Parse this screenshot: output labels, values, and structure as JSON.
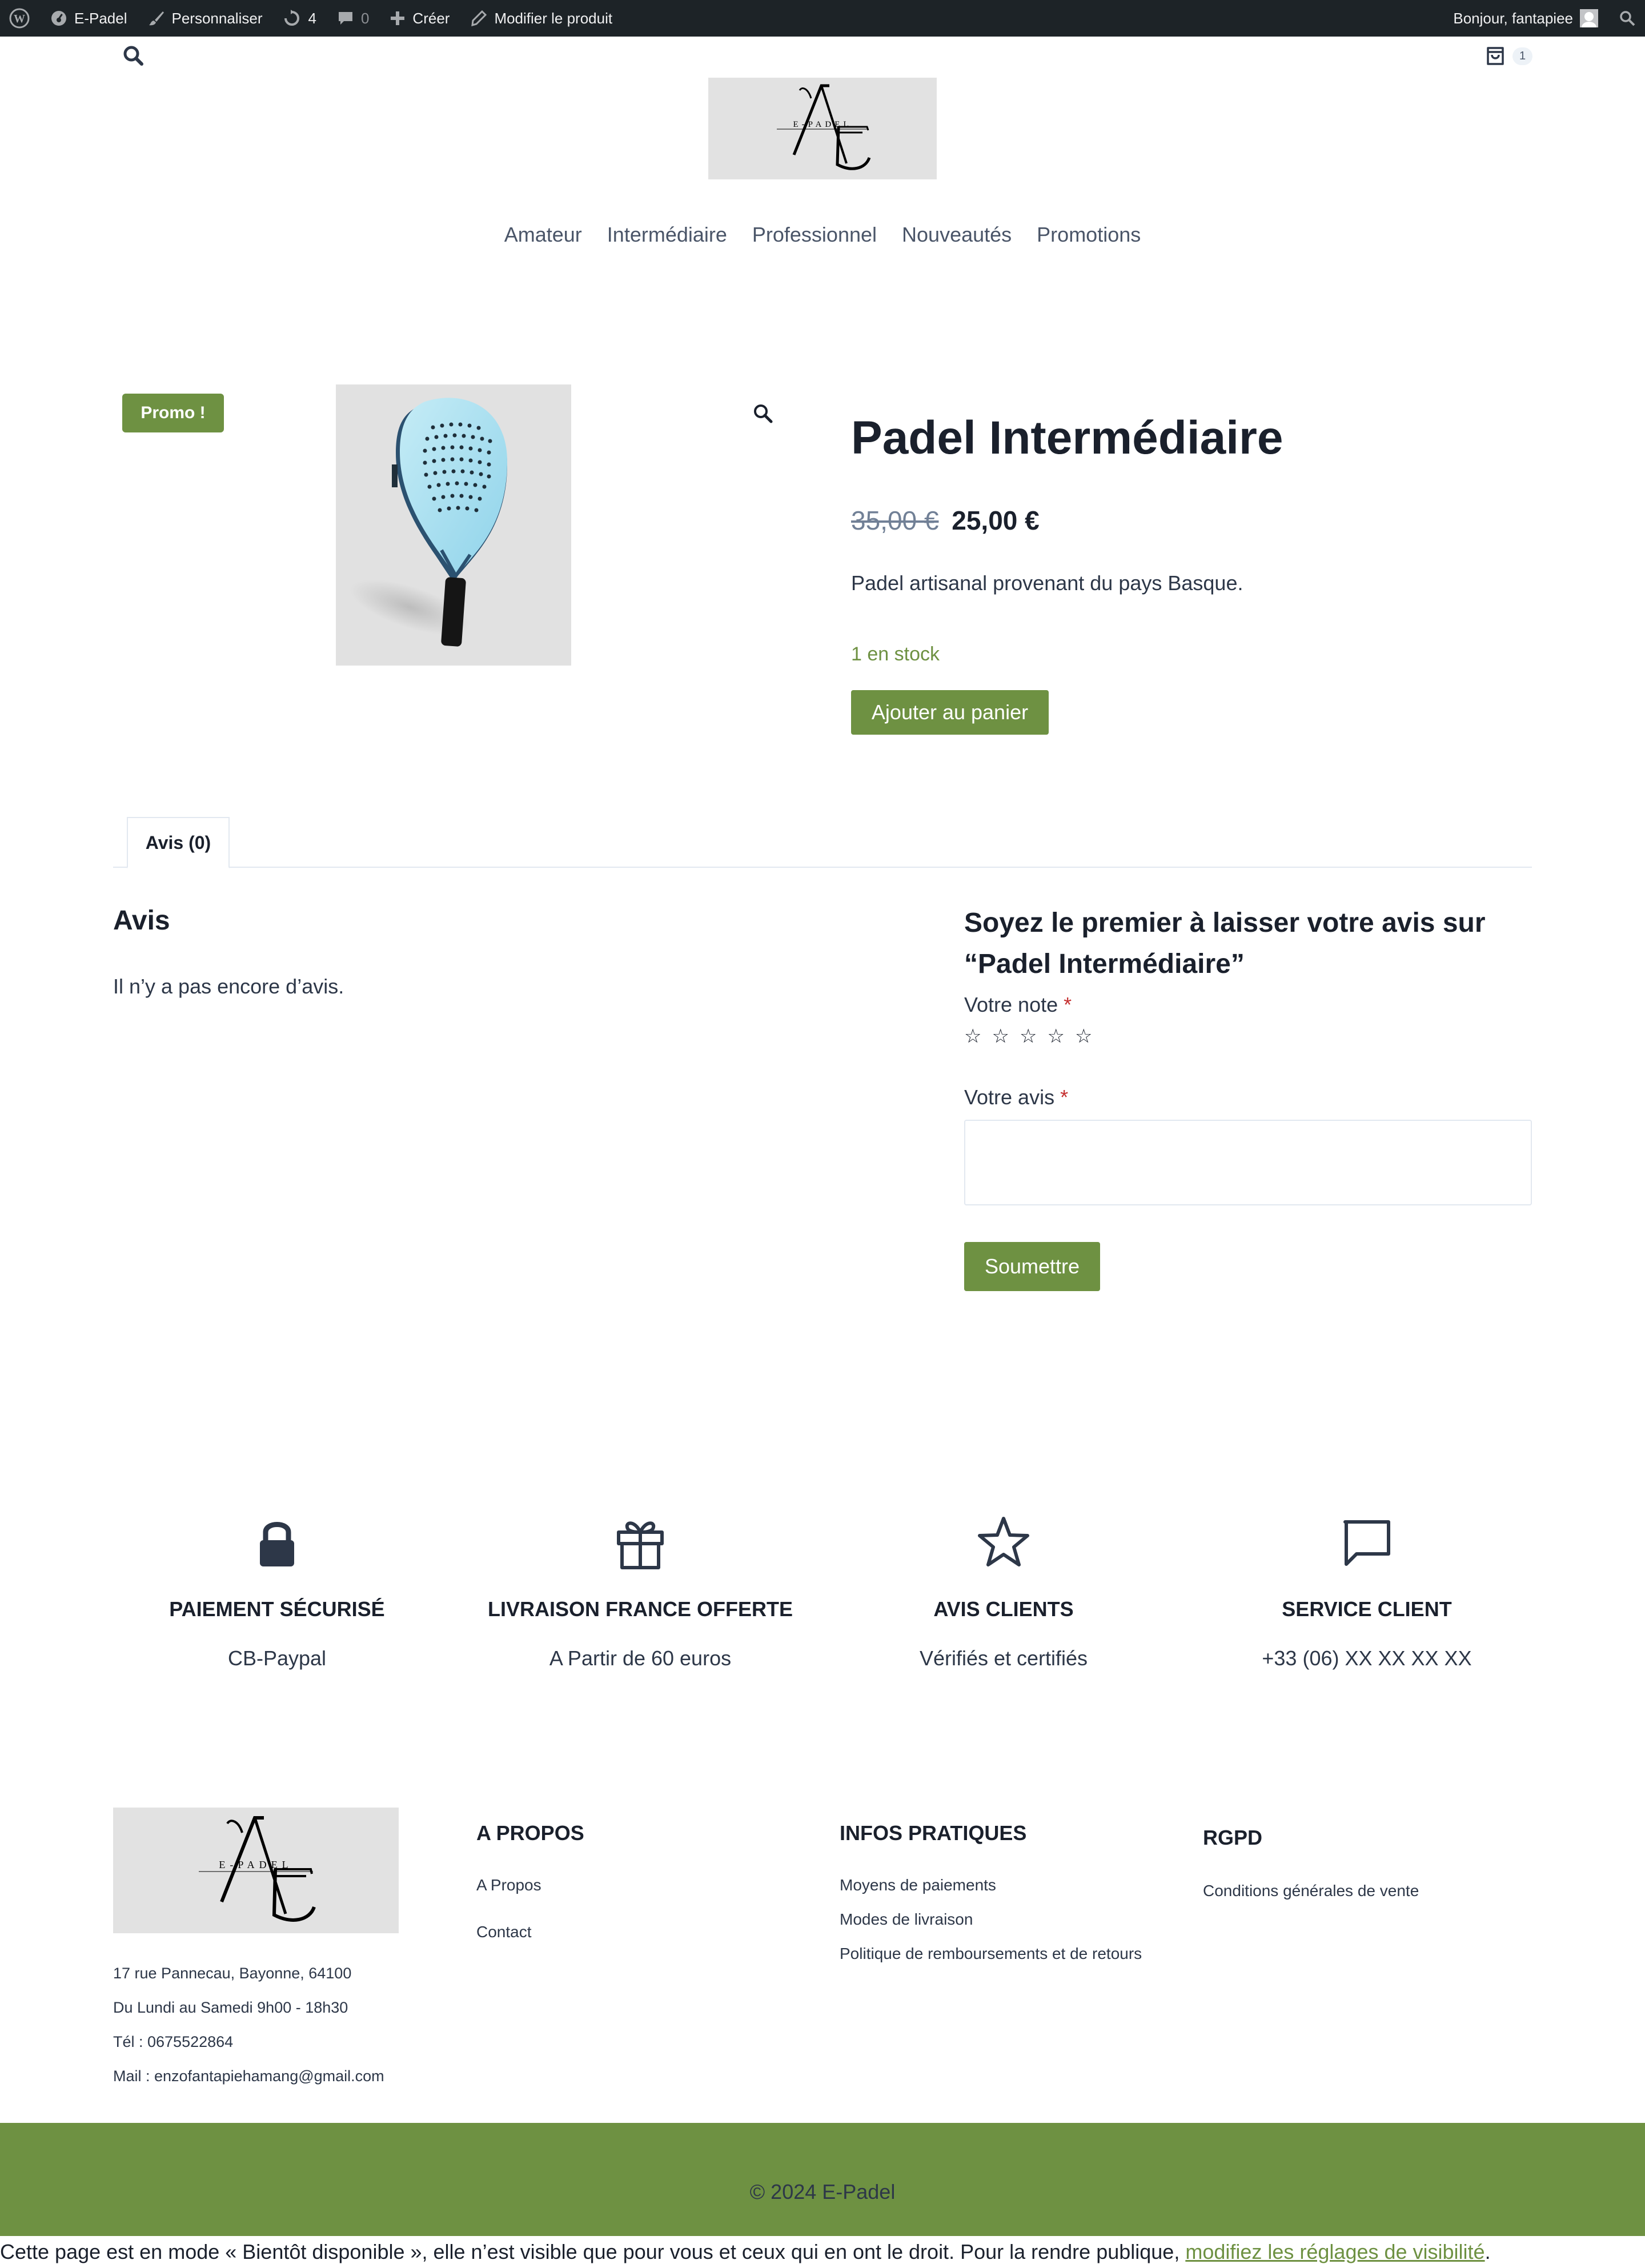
{
  "adminbar": {
    "site_name": "E-Padel",
    "customize": "Personnaliser",
    "updates_count": "4",
    "comments_count": "0",
    "new": "Créer",
    "edit_product": "Modifier le produit",
    "greeting": "Bonjour, fantapiee"
  },
  "header": {
    "cart_count": "1",
    "nav": [
      "Amateur",
      "Intermédiaire",
      "Professionnel",
      "Nouveautés",
      "Promotions"
    ]
  },
  "logo": {
    "mark": "AE",
    "tagline": "E-PADEL"
  },
  "product": {
    "badge": "Promo !",
    "title": "Padel Intermédiaire",
    "price_old": "35,00 €",
    "price_new": "25,00 €",
    "short_description": "Padel artisanal provenant du pays Basque.",
    "stock": "1 en stock",
    "add_to_cart": "Ajouter au panier"
  },
  "tabs": {
    "reviews_tab": "Avis (0)"
  },
  "reviews": {
    "title": "Avis",
    "empty": "Il n’y a pas encore d’avis.",
    "form_title": "Soyez le premier à laisser votre avis sur “Padel Intermédiaire”",
    "rating_label": "Votre note",
    "review_label": "Votre avis",
    "required_mark": "*",
    "stars": [
      "☆",
      "☆",
      "☆",
      "☆",
      "☆"
    ],
    "submit": "Soumettre"
  },
  "features": [
    {
      "icon": "lock-icon",
      "title": "PAIEMENT SÉCURISÉ",
      "subtitle": "CB-Paypal"
    },
    {
      "icon": "gift-icon",
      "title": "LIVRAISON FRANCE OFFERTE",
      "subtitle": "A Partir de 60 euros"
    },
    {
      "icon": "star-icon",
      "title": "AVIS CLIENTS",
      "subtitle": "Vérifiés et certifiés"
    },
    {
      "icon": "message-icon",
      "title": "SERVICE CLIENT",
      "subtitle": "+33 (06) XX XX XX XX"
    }
  ],
  "footer": {
    "address": [
      "17 rue Pannecau, Bayonne, 64100",
      "Du Lundi au Samedi 9h00 - 18h30",
      "Tél : 0675522864",
      "Mail : enzofantapiehamang@gmail.com"
    ],
    "about": {
      "title": "A PROPOS",
      "links": [
        "A Propos",
        "Contact"
      ]
    },
    "infos": {
      "title": "INFOS PRATIQUES",
      "links": [
        "Moyens de paiements",
        "Modes de livraison",
        "Politique de remboursements et de retours"
      ]
    },
    "rgpd": {
      "title": "RGPD",
      "links": [
        "Conditions générales de vente"
      ]
    },
    "copyright": "© 2024 E-Padel"
  },
  "coming_soon": {
    "text": "Cette page est en mode « Bientôt disponible », elle n’est visible que pour vous et ceux qui en ont le droit. Pour la rendre publique, ",
    "link": "modifiez les réglages de visibilité",
    "end": "."
  },
  "colors": {
    "accent": "#6e9142",
    "adminbar": "#1d2327",
    "heading": "#1a202c"
  }
}
